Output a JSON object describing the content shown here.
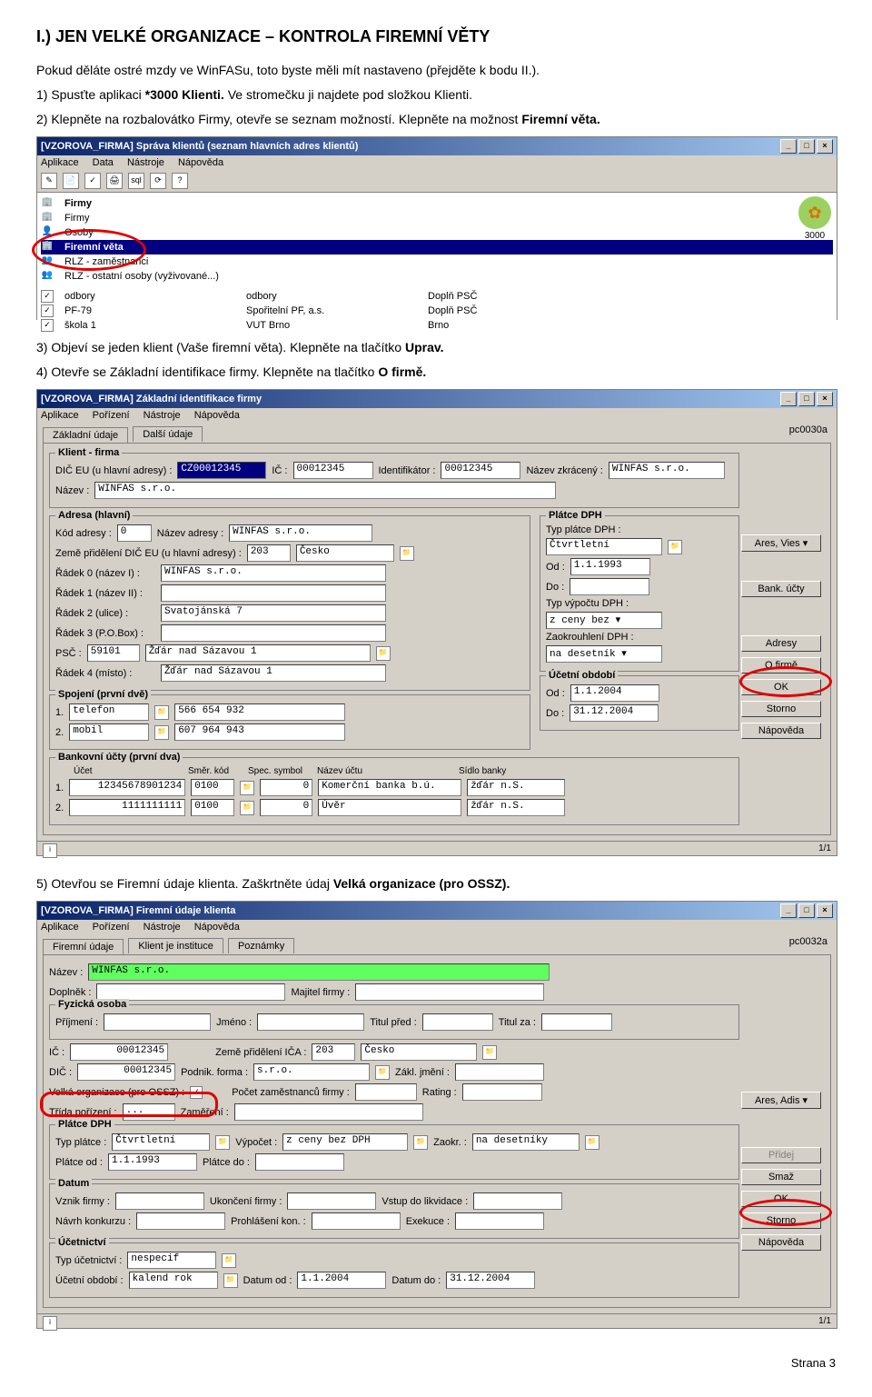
{
  "heading": "I.) JEN VELKÉ ORGANIZACE – KONTROLA FIREMNÍ VĚTY",
  "intro": "Pokud děláte ostré mzdy ve WinFASu, toto byste měli mít nastaveno (přejděte k bodu II.).",
  "step1": "1) Spusťte aplikaci ",
  "step1b": "*3000 Klienti.",
  "step1c": " Ve stromečku ji najdete pod složkou Klienti.",
  "step2": "2) Klepněte na rozbalovátko Firmy, otevře se seznam možností. Klepněte na možnost ",
  "step2b": "Firemní věta.",
  "step3": "3) Objeví se jeden klient (Vaše firemní věta). Klepněte na tlačítko ",
  "step3b": "Uprav.",
  "step4": "4) Otevře se Základní identifikace firmy. Klepněte na tlačítko ",
  "step4b": "O firmě.",
  "step5": "5) Otevřou se Firemní údaje klienta. Zaškrtněte údaj ",
  "step5b": "Velká organizace (pro OSSZ).",
  "footer": "Strana 3",
  "win1": {
    "title": "[VZOROVA_FIRMA] Správa klientů (seznam hlavních adres klientů)",
    "menu": [
      "Aplikace",
      "Data",
      "Nástroje",
      "Nápověda"
    ],
    "version": "3000",
    "items": [
      {
        "t": "Firmy",
        "sel": false
      },
      {
        "t": "Firmy",
        "sel": false
      },
      {
        "t": "Osoby",
        "sel": false
      },
      {
        "t": "Firemní věta",
        "sel": true
      },
      {
        "t": "RLZ - zaměstnanci",
        "sel": false
      },
      {
        "t": "RLZ - ostatní osoby (vyživované...)",
        "sel": false
      }
    ],
    "rows": [
      {
        "c1": "odbory",
        "c2": "odbory",
        "c3": "Doplň PSČ"
      },
      {
        "c1": "PF-79",
        "c2": "Spořitelní PF, a.s.",
        "c3": "Doplň PSČ"
      },
      {
        "c1": "škola 1",
        "c2": "VUT Brno",
        "c3": "Brno"
      }
    ]
  },
  "win2": {
    "title": "[VZOROVA_FIRMA] Základní identifikace firmy",
    "menu": [
      "Aplikace",
      "Pořízení",
      "Nástroje",
      "Nápověda"
    ],
    "pc": "pc0030a",
    "tabs": [
      "Základní údaje",
      "Další údaje"
    ],
    "klient_legend": "Klient - firma",
    "dic_lbl": "DIČ EU (u hlavní adresy) :",
    "dic": "CZ00012345",
    "ic_lbl": "IČ :",
    "ic": "00012345",
    "ident_lbl": "Identifikátor :",
    "ident": "00012345",
    "nazevz_lbl": "Název zkrácený :",
    "nazevz": "WINFAS s.r.o.",
    "nazev_lbl": "Název :",
    "nazev": "WINFAS s.r.o.",
    "adresa_legend": "Adresa (hlavní)",
    "kadr_lbl": "Kód adresy :",
    "kadr": "0",
    "nadr_lbl": "Název adresy :",
    "nadr": "WINFAS s.r.o.",
    "zeme_lbl": "Země přidělení DIČ EU (u hlavní adresy) :",
    "zeme_kod": "203",
    "zeme": "Česko",
    "r0_lbl": "Řádek 0 (název I) :",
    "r0": "WINFAS s.r.o.",
    "r1_lbl": "Řádek 1 (název II) :",
    "r1": "",
    "r2_lbl": "Řádek 2 (ulice) :",
    "r2": "Svatojánská 7",
    "r3_lbl": "Řádek 3 (P.O.Box) :",
    "r3": "",
    "psc_lbl": "PSČ :",
    "psc": "59101",
    "psc2": "Žďár nad Sázavou 1",
    "r4_lbl": "Řádek 4 (místo) :",
    "r4": "Žďár nad Sázavou 1",
    "platce_legend": "Plátce DPH",
    "typpl_lbl": "Typ plátce DPH :",
    "typpl": "Čtvrtletní",
    "od_lbl": "Od :",
    "od": "1.1.1993",
    "do_lbl": "Do :",
    "do_": "",
    "typvyp_lbl": "Typ výpočtu DPH :",
    "typvyp": "z ceny bez ▾",
    "zaokr_lbl": "Zaokrouhlení DPH :",
    "zaokr": "na desetník ▾",
    "uco_legend": "Účetní období",
    "uco_od_lbl": "Od :",
    "uco_od": "1.1.2004",
    "uco_do_lbl": "Do :",
    "uco_do": "31.12.2004",
    "spoj_legend": "Spojení (první dvě)",
    "spoj1_typ": "telefon",
    "spoj1_val": "566 654 932",
    "spoj2_typ": "mobil",
    "spoj2_val": "607 964 943",
    "bank_legend": "Bankovní účty (první dva)",
    "bank_hdr": [
      "Účet",
      "Směr. kód",
      "Spec. symbol",
      "Název účtu",
      "Sídlo banky"
    ],
    "bank1": [
      "12345678901234",
      "0100",
      "0",
      "Komerční banka b.ú.",
      "žďár n.S."
    ],
    "bank2": [
      "1111111111",
      "0100",
      "0",
      "Úvěr",
      "žďár n.S."
    ],
    "btns": [
      "Ares, Vies ▾",
      "Bank. účty",
      "Adresy",
      "O firmě",
      "OK",
      "Storno",
      "Nápověda"
    ],
    "status": "1/1"
  },
  "win3": {
    "title": "[VZOROVA_FIRMA] Firemní údaje klienta",
    "menu": [
      "Aplikace",
      "Pořízení",
      "Nástroje",
      "Nápověda"
    ],
    "pc": "pc0032a",
    "tabs": [
      "Firemní údaje",
      "Klient je instituce",
      "Poznámky"
    ],
    "nazev_lbl": "Název :",
    "nazev": "WINFAS s.r.o.",
    "dopln_lbl": "Doplněk :",
    "dopln": "",
    "majitel_lbl": "Majitel firmy :",
    "majitel": "",
    "fyz_legend": "Fyzická osoba",
    "prij_lbl": "Příjmení :",
    "jmeno_lbl": "Jméno :",
    "tpred_lbl": "Titul před :",
    "tza_lbl": "Titul za :",
    "ic_lbl": "IČ :",
    "ic": "00012345",
    "zeme_lbl": "Země přidělení IČA :",
    "zeme_kod": "203",
    "zeme": "Česko",
    "dic_lbl": "DIČ :",
    "dic": "00012345",
    "podf_lbl": "Podnik. forma :",
    "podf": "s.r.o.",
    "zakl_lbl": "Zákl. jmění :",
    "zakl": "",
    "velka_lbl": "Velká organizace (pro OSSZ) :",
    "pocet_lbl": "Počet zaměstnanců firmy :",
    "pocet": "",
    "rating_lbl": "Rating :",
    "rating": "",
    "trida_lbl": "Třída pořízení :",
    "trida": "...",
    "zamer_lbl": "Zaměření :",
    "zamer": "",
    "platce_legend": "Plátce DPH",
    "typpl_lbl": "Typ plátce :",
    "typpl": "Čtvrtletní",
    "vypoc_lbl": "Výpočet :",
    "vypoc": "z ceny bez DPH",
    "zaokr_lbl": "Zaokr. :",
    "zaokr": "na desetníky",
    "plod_lbl": "Plátce od :",
    "plod": "1.1.1993",
    "pldo_lbl": "Plátce do :",
    "pldo": "",
    "datum_legend": "Datum",
    "vznik_lbl": "Vznik firmy :",
    "ukon_lbl": "Ukončení firmy :",
    "vstup_lbl": "Vstup do likvidace :",
    "navrh_lbl": "Návrh konkurzu :",
    "prohl_lbl": "Prohlášení kon. :",
    "exek_lbl": "Exekuce :",
    "ucet_legend": "Účetnictví",
    "typuc_lbl": "Typ účetnictví :",
    "typuc": "nespecif",
    "ucob_lbl": "Účetní období :",
    "ucob": "kalend rok",
    "dod_lbl": "Datum od :",
    "dod": "1.1.2004",
    "ddo_lbl": "Datum do :",
    "ddo": "31.12.2004",
    "btns": [
      "Ares, Adis ▾",
      "Přidej",
      "Smaž",
      "OK",
      "Storno",
      "Nápověda"
    ],
    "status": "1/1"
  }
}
